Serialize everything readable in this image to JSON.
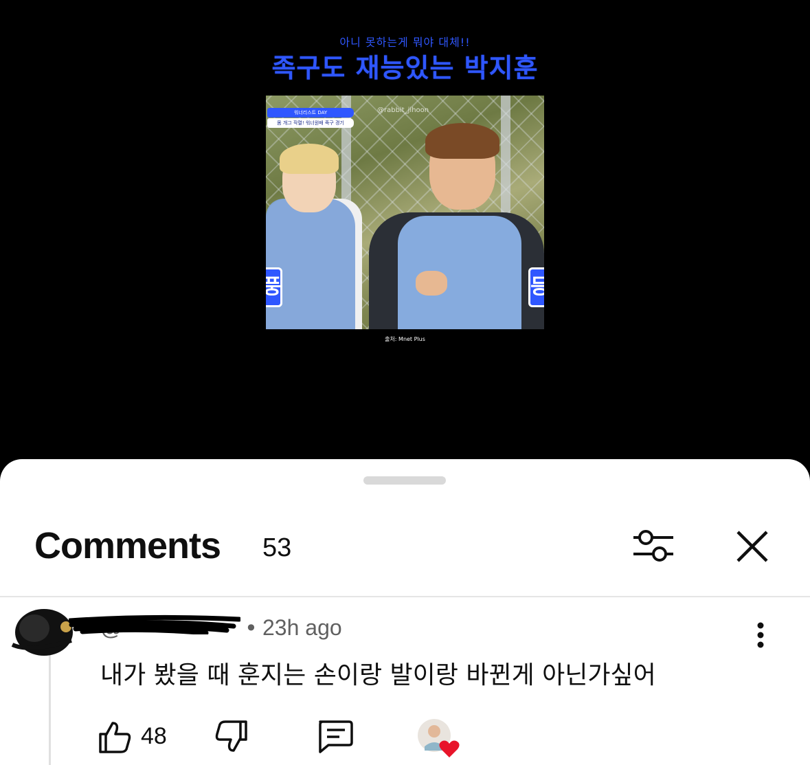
{
  "video": {
    "caption_top": "아니 못하는게 뭐야 대체!!",
    "caption_main": "족구도 재능있는 박지훈",
    "badge_line1": "워너리스트 DAY",
    "badge_line2": "몸 개그 작렬! 워너원배 족구 경기",
    "watermark": "@rabbit_jihoon",
    "side_glyph_left": "풍",
    "side_glyph_right": "등",
    "source_note": "출처: Mnet Plus"
  },
  "comments_panel": {
    "title": "Comments",
    "count": "53",
    "filter_icon": "sliders-icon",
    "close_icon": "close-icon"
  },
  "comment": {
    "author": "@",
    "time": "23h ago",
    "separator": "•",
    "text": "내가 봤을 때 훈지는 손이랑 발이랑 바뀐게 아닌가싶어",
    "likes": "48",
    "icons": [
      "thumbs-up-icon",
      "thumbs-down-icon",
      "reply-icon",
      "more-vert-icon",
      "creator-heart-icon"
    ],
    "heart_color": "#e8142a"
  }
}
